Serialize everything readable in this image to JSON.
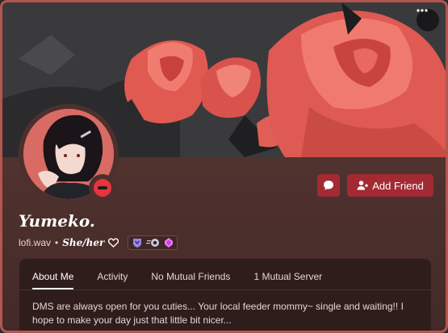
{
  "profile": {
    "display_name": "Yumeko.",
    "username": "lofi.wav",
    "separator": "•",
    "pronouns": "She/her",
    "pronouns_suffix_icon": "heart-icon",
    "status": "do-not-disturb"
  },
  "actions": {
    "more_icon": "more-options-icon",
    "message_icon": "message-icon",
    "add_friend_label": "Add Friend"
  },
  "badges": [
    "hypesquad-badge",
    "nitro-badge",
    "boost-gem-badge"
  ],
  "tabs": [
    {
      "label": "About Me",
      "active": true
    },
    {
      "label": "Activity",
      "active": false
    },
    {
      "label": "No Mutual Friends",
      "active": false
    },
    {
      "label": "1 Mutual Server",
      "active": false
    }
  ],
  "about_me": "DMS are always open for you cuties... Your local feeder mommy~ single and waiting!! I hope to make your day just that little bit nicer...",
  "colors": {
    "border": "#b3564f",
    "accent_button": "#a32a33",
    "status_dnd": "#e7333d",
    "panel": "#2f1d1c"
  }
}
